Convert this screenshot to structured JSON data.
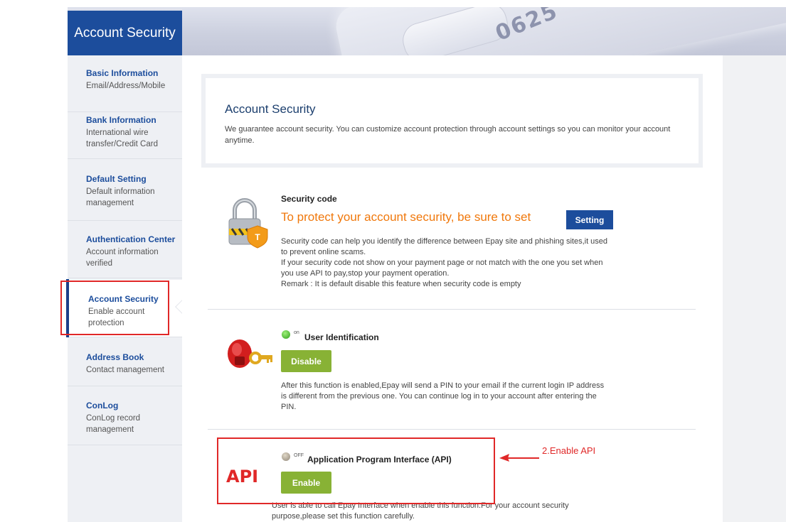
{
  "banner": {
    "title": "Account Security",
    "card_digits": "0625"
  },
  "sidebar": {
    "items": [
      {
        "title": "Basic Information",
        "desc": "Email/Address/Mobile"
      },
      {
        "title": "Bank Information",
        "desc": "International wire transfer/Credit Card"
      },
      {
        "title": "Default Setting",
        "desc": "Default information management"
      },
      {
        "title": "Authentication Center",
        "desc": "Account information verified"
      },
      {
        "title": "Account Security",
        "desc": "Enable account protection",
        "active": true
      },
      {
        "title": "Address Book",
        "desc": "Contact management"
      },
      {
        "title": "ConLog",
        "desc": "ConLog record management"
      }
    ]
  },
  "intro": {
    "title": "Account Security",
    "text": "We guarantee account security. You can customize account protection through account settings so you can monitor your account anytime."
  },
  "security_code": {
    "title": "Security code",
    "warning": "To protect your account security, be sure to set",
    "button": "Setting",
    "desc_1": "Security code can help you identify the difference between Epay site and phishing sites,it used to prevent online scams.",
    "desc_2": "If your security code not show on your payment page or not match with the one you set when you use API to pay,stop your payment operation.",
    "desc_3": "Remark : It is default disable this feature when security code is empty"
  },
  "user_identification": {
    "status": "on",
    "title": "User Identification",
    "button": "Disable",
    "desc": "After this function is enabled,Epay will send a PIN to your email if the current login IP address is different from the previous one. You can continue log in to your account after entering the PIN."
  },
  "api": {
    "status": "OFF",
    "title": "Application Program Interface (API)",
    "button": "Enable",
    "desc": "User is able to call Epay Interface when enable this function.For your account security purpose,please set this function carefully."
  },
  "annotations": {
    "api_label": "API",
    "enable_api": "2.Enable API"
  },
  "colors": {
    "brand_blue": "#1c4d9c",
    "accent_orange": "#f0780c",
    "button_green": "#88b235",
    "annotation_red": "#e02828"
  }
}
